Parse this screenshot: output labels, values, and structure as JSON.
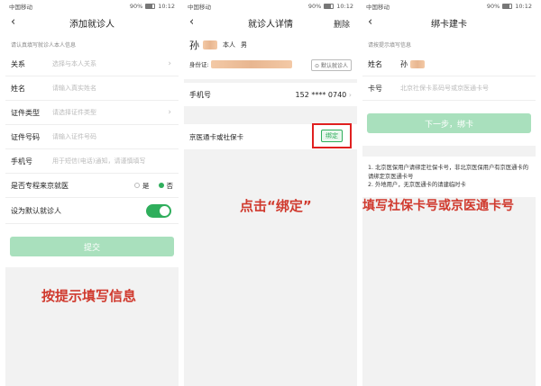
{
  "status": {
    "carrier": "中国移动",
    "battery": "90%",
    "time": "10:12"
  },
  "panel1": {
    "title": "添加就诊人",
    "hint": "请认真填写就诊人本人信息",
    "fields": [
      {
        "label": "关系",
        "placeholder": "选择与本人关系",
        "chevron": true
      },
      {
        "label": "姓名",
        "placeholder": "请输入真实姓名",
        "chevron": false
      },
      {
        "label": "证件类型",
        "placeholder": "请选择证件类型",
        "chevron": true
      },
      {
        "label": "证件号码",
        "placeholder": "请输入证件号码",
        "chevron": false
      },
      {
        "label": "手机号",
        "placeholder": "用于短信(电话)通知，请谨慎填写",
        "chevron": false
      }
    ],
    "beijing_label": "是否专程来京就医",
    "opt_yes": "是",
    "opt_no": "否",
    "default_label": "设为默认就诊人",
    "submit": "提交",
    "caption": "按提示填写信息"
  },
  "panel2": {
    "title": "就诊人详情",
    "delete": "删除",
    "name": "孙",
    "relation": "本人",
    "gender": "男",
    "id_label": "身份证:",
    "default_btn": "默认就诊人",
    "phone_label": "手机号",
    "phone_value": "152 **** 0740",
    "card_label": "京医通卡或社保卡",
    "bind": "绑定",
    "caption": "点击“绑定”"
  },
  "panel3": {
    "title": "绑卡建卡",
    "hint": "请按提示填写信息",
    "name_label": "姓名",
    "name_value": "孙",
    "card_label": "卡号",
    "card_placeholder": "北京社保卡系码号或京医通卡号",
    "next": "下一步，绑卡",
    "info_1": "1. 北京医保用户请绑定社保卡号，非北京医保用户有京医通卡的请绑定京医通卡号",
    "info_2": "2. 外地用户，无京医通卡的请建临时卡",
    "caption": "填写社保卡号或京医通卡号"
  },
  "colors": {
    "accent": "#2fae5c",
    "caption": "#d03a2e",
    "highlight": "#e02020"
  }
}
